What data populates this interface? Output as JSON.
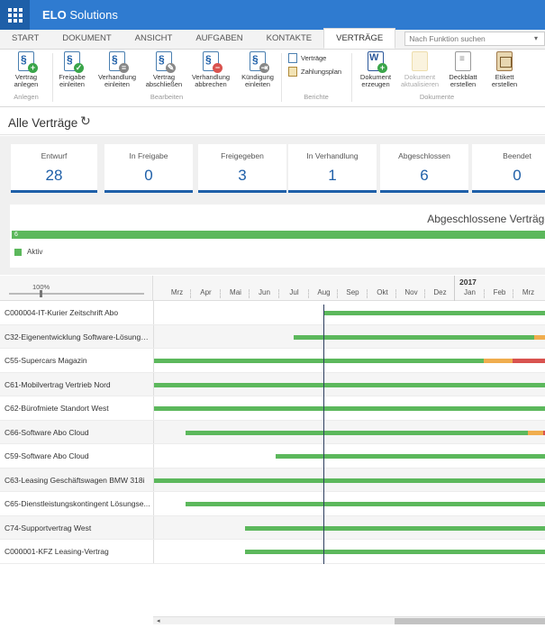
{
  "app": {
    "brand": "ELO",
    "name": "Solutions"
  },
  "tabs": [
    "START",
    "DOKUMENT",
    "ANSICHT",
    "AUFGABEN",
    "KONTAKTE",
    "VERTRÄGE"
  ],
  "active_tab_index": 5,
  "search": {
    "placeholder": "Nach Funktion suchen"
  },
  "ribbon": {
    "groups": {
      "anlegen": "Anlegen",
      "bearbeiten": "Bearbeiten",
      "berichte": "Berichte",
      "dokumente": "Dokumente"
    },
    "buttons": {
      "vertrag_anlegen": {
        "line1": "Vertrag",
        "line2": "anlegen",
        "icon": "contract-add-icon"
      },
      "freigabe_einleiten": {
        "line1": "Freigabe",
        "line2": "einleiten",
        "icon": "contract-approve-icon"
      },
      "verhandlung_einleiten": {
        "line1": "Verhandlung",
        "line2": "einleiten",
        "icon": "contract-negotiate-icon"
      },
      "vertrag_abschliessen": {
        "line1": "Vertrag",
        "line2": "abschließen",
        "icon": "contract-sign-icon"
      },
      "verhandlung_abbrechen": {
        "line1": "Verhandlung",
        "line2": "abbrechen",
        "icon": "contract-cancel-icon"
      },
      "kuendigung_einleiten": {
        "line1": "Kündigung",
        "line2": "einleiten",
        "icon": "contract-terminate-icon"
      },
      "vertraege": {
        "label": "Verträge",
        "icon": "report-contracts-icon"
      },
      "zahlungsplan": {
        "label": "Zahlungsplan",
        "icon": "payment-plan-icon"
      },
      "dokument_erzeugen": {
        "line1": "Dokument",
        "line2": "erzeugen",
        "icon": "word-document-add-icon"
      },
      "dokument_aktualisieren": {
        "line1": "Dokument",
        "line2": "aktualisieren",
        "icon": "document-refresh-icon"
      },
      "deckblatt_erstellen": {
        "line1": "Deckblatt",
        "line2": "erstellen",
        "icon": "cover-sheet-icon"
      },
      "etikett_erstellen": {
        "line1": "Etikett",
        "line2": "erstellen",
        "icon": "label-print-icon"
      }
    }
  },
  "page": {
    "title": "Alle Verträge"
  },
  "kpis": [
    {
      "label": "Entwurf",
      "value": "28"
    },
    {
      "label": "In Freigabe",
      "value": "0"
    },
    {
      "label": "Freigegeben",
      "value": "3"
    },
    {
      "label": "In Verhandlung",
      "value": "1"
    },
    {
      "label": "Abgeschlossen",
      "value": "6"
    },
    {
      "label": "Beendet",
      "value": "0"
    }
  ],
  "abgeschlossen": {
    "title": "Abgeschlossene Verträge",
    "bar_value": "6",
    "legend": "Aktiv",
    "color": "#5cb85c"
  },
  "timeline": {
    "zoom": "100%",
    "year": "2017",
    "months": [
      "Mrz",
      "Apr",
      "Mai",
      "Jun",
      "Jul",
      "Aug",
      "Sep",
      "Okt",
      "Nov",
      "Dez",
      "Jan",
      "Feb",
      "Mrz"
    ],
    "colors": {
      "active": "#5cb85c",
      "warning": "#f0ad4e",
      "expired": "#d9534f",
      "today_line": "#2d3e5f"
    }
  },
  "contracts": [
    "C000004-IT-Kurier Zeitschrift Abo",
    "C32-Eigenentwicklung Software-Lösung \"...",
    "C55-Supercars Magazin",
    "C61-Mobilvertrag Vertrieb Nord",
    "C62-Bürofmiete Standort West",
    "C66-Software Abo Cloud",
    "C59-Software Abo Cloud",
    "C63-Leasing Geschäftswagen BMW 318i",
    "C65-Dienstleistungskontingent Lösungse...",
    "C74-Supportvertrag West",
    "C000001-KFZ Leasing-Vertrag"
  ]
}
